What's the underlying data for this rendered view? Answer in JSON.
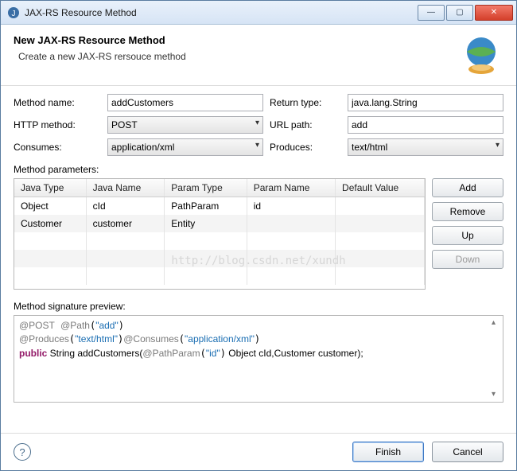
{
  "window": {
    "title": "JAX-RS Resource Method"
  },
  "header": {
    "title": "New JAX-RS Resource Method",
    "subtitle": "Create a new JAX-RS rersouce method"
  },
  "form": {
    "method_name_label": "Method name:",
    "method_name_value": "addCustomers",
    "return_type_label": "Return type:",
    "return_type_value": "java.lang.String",
    "http_method_label": "HTTP method:",
    "http_method_value": "POST",
    "url_path_label": "URL path:",
    "url_path_value": "add",
    "consumes_label": "Consumes:",
    "consumes_value": "application/xml",
    "produces_label": "Produces:",
    "produces_value": "text/html"
  },
  "params": {
    "section_label": "Method parameters:",
    "headers": {
      "java_type": "Java Type",
      "java_name": "Java Name",
      "param_type": "Param Type",
      "param_name": "Param Name",
      "default_value": "Default Value"
    },
    "rows": [
      {
        "java_type": "Object",
        "java_name": "cId",
        "param_type": "PathParam",
        "param_name": "id",
        "default_value": ""
      },
      {
        "java_type": "Customer",
        "java_name": "customer",
        "param_type": "Entity",
        "param_name": "",
        "default_value": ""
      }
    ],
    "buttons": {
      "add": "Add",
      "remove": "Remove",
      "up": "Up",
      "down": "Down"
    }
  },
  "signature": {
    "label": "Method signature preview:",
    "line1_a": "@POST",
    "line1_b": "@Path",
    "line1_c": "\"add\"",
    "line2_a": "@Produces",
    "line2_b": "\"text/html\"",
    "line2_c": "@Consumes",
    "line2_d": "\"application/xml\"",
    "line3_a": "public",
    "line3_b": " String addCustomers(",
    "line3_c": "@PathParam",
    "line3_d": "\"id\"",
    "line3_e": " Object cId,Customer customer);"
  },
  "footer": {
    "finish": "Finish",
    "cancel": "Cancel"
  },
  "watermark": "http://blog.csdn.net/xundh"
}
